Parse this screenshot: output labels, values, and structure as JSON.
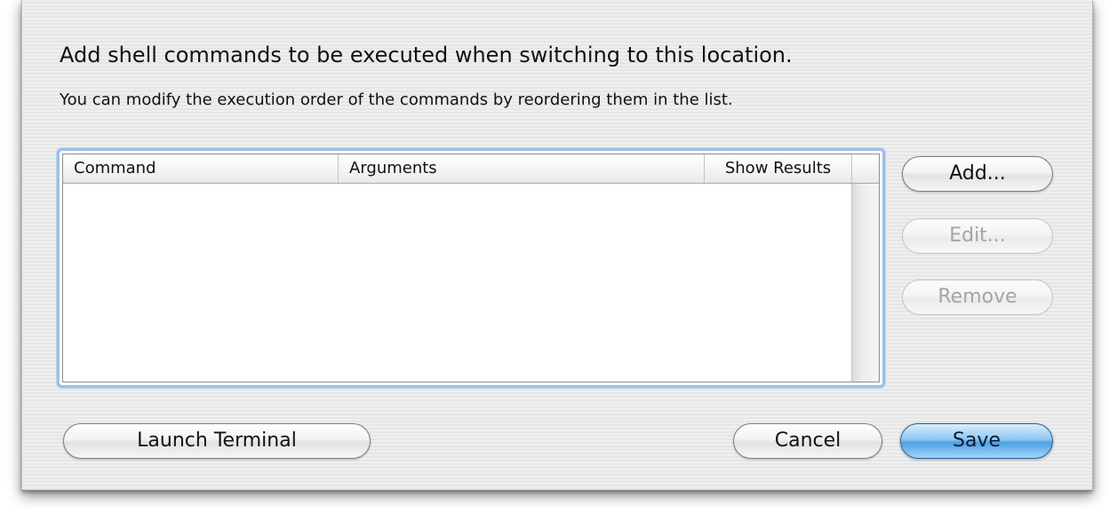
{
  "dialog": {
    "headline": "Add shell commands to be executed when switching to this location.",
    "subline": "You can modify the execution order of the commands by reordering them in the list."
  },
  "table": {
    "columns": [
      "Command",
      "Arguments",
      "Show Results"
    ],
    "rows": []
  },
  "side_buttons": {
    "add": "Add...",
    "edit": "Edit...",
    "remove": "Remove"
  },
  "footer": {
    "launch_terminal": "Launch Terminal",
    "cancel": "Cancel",
    "save": "Save"
  },
  "colors": {
    "sheet_background": "#ececec",
    "focus_ring": "#9cc0e6",
    "default_button": "#4ea1e4",
    "disabled_text": "#a5a5a5"
  }
}
